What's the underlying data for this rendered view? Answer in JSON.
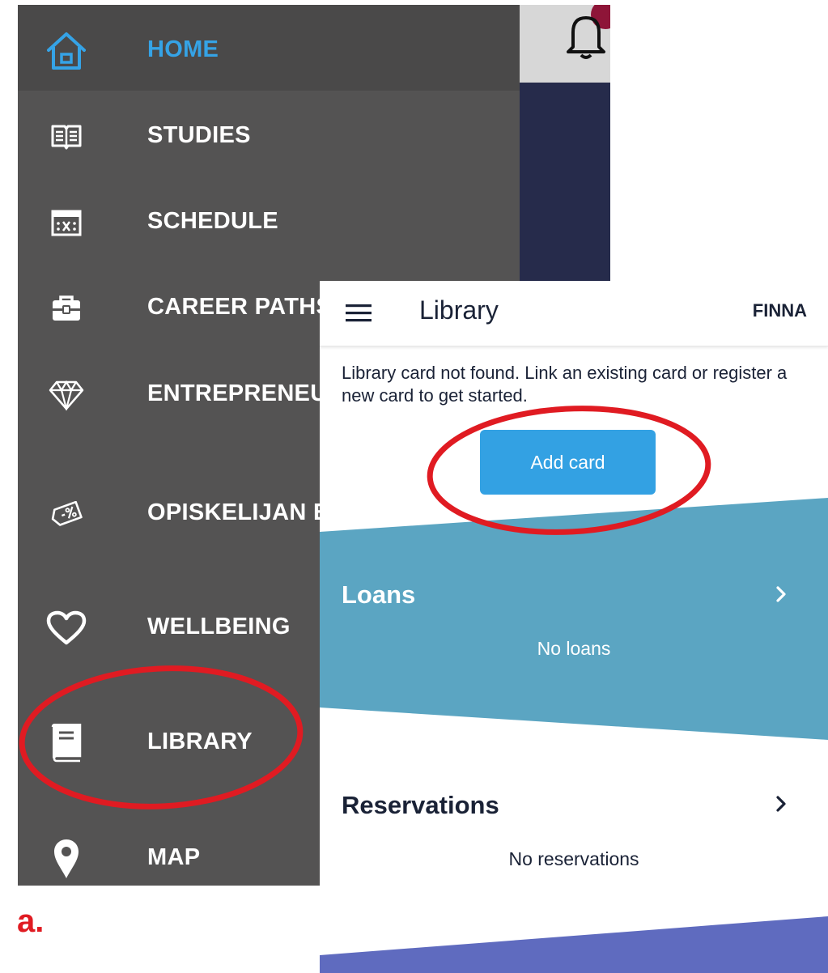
{
  "drawer": {
    "items": [
      {
        "label": "HOME",
        "icon": "home-icon",
        "active": true
      },
      {
        "label": "STUDIES",
        "icon": "book-open-icon"
      },
      {
        "label": "SCHEDULE",
        "icon": "calendar-icon"
      },
      {
        "label": "CAREER PATHS",
        "icon": "briefcase-icon"
      },
      {
        "label": "ENTREPRENEU",
        "icon": "diamond-icon"
      },
      {
        "label": "OPISKELIJAN E",
        "icon": "discount-tag-icon"
      },
      {
        "label": "WELLBEING",
        "icon": "heart-icon"
      },
      {
        "label": "LIBRARY",
        "icon": "library-book-icon"
      },
      {
        "label": "MAP",
        "icon": "map-pin-icon"
      }
    ],
    "colors": {
      "background": "#545353",
      "active_text": "#35a3e6",
      "text": "#ffffff"
    }
  },
  "library": {
    "title": "Library",
    "finna_link": "FINNA",
    "card_message": "Library card not found. Link an existing card or register a new card to get started.",
    "add_card_label": "Add card",
    "loans": {
      "title": "Loans",
      "empty_text": "No loans"
    },
    "reservations": {
      "title": "Reservations",
      "empty_text": "No reservations"
    },
    "colors": {
      "accent_button": "#33a1e3",
      "loans_band": "#5ba5c2",
      "bottom_band": "#5f6bbf",
      "text_dark": "#1a2236"
    }
  },
  "figure_label": "a.",
  "annotation_color": "#e01b22"
}
